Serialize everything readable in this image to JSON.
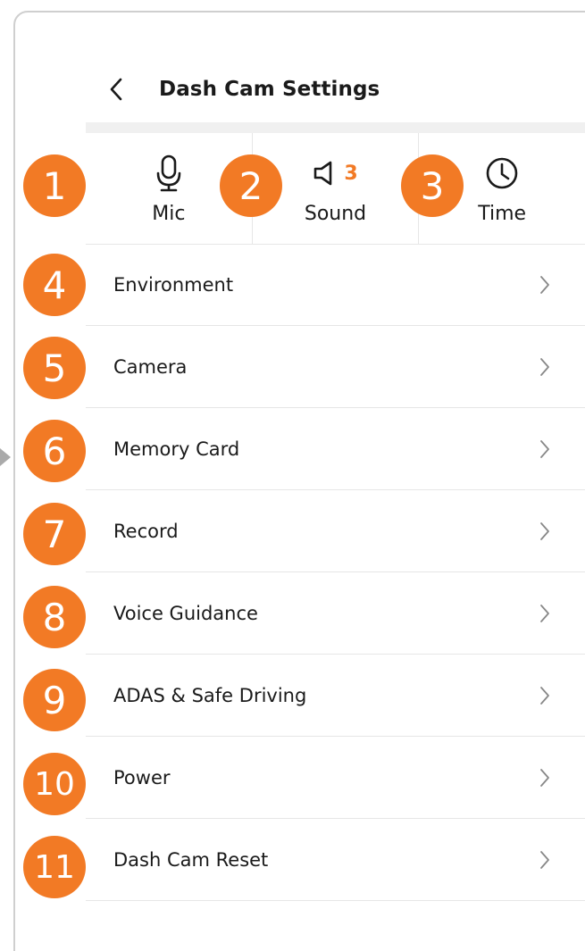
{
  "header": {
    "title": "Dash Cam Settings"
  },
  "quick_settings": [
    {
      "label": "Mic",
      "icon": "mic-icon"
    },
    {
      "label": "Sound",
      "icon": "speaker-icon",
      "value": "3"
    },
    {
      "label": "Time",
      "icon": "clock-icon"
    }
  ],
  "menu": [
    {
      "label": "Environment"
    },
    {
      "label": "Camera"
    },
    {
      "label": "Memory Card"
    },
    {
      "label": "Record"
    },
    {
      "label": "Voice Guidance"
    },
    {
      "label": "ADAS & Safe Driving"
    },
    {
      "label": "Power"
    },
    {
      "label": "Dash Cam Reset"
    }
  ],
  "markers": [
    "1",
    "2",
    "3",
    "4",
    "5",
    "6",
    "7",
    "8",
    "9",
    "10",
    "11"
  ],
  "colors": {
    "accent": "#f27a25",
    "divider": "#e6e6e6",
    "text": "#1a1a1a"
  }
}
